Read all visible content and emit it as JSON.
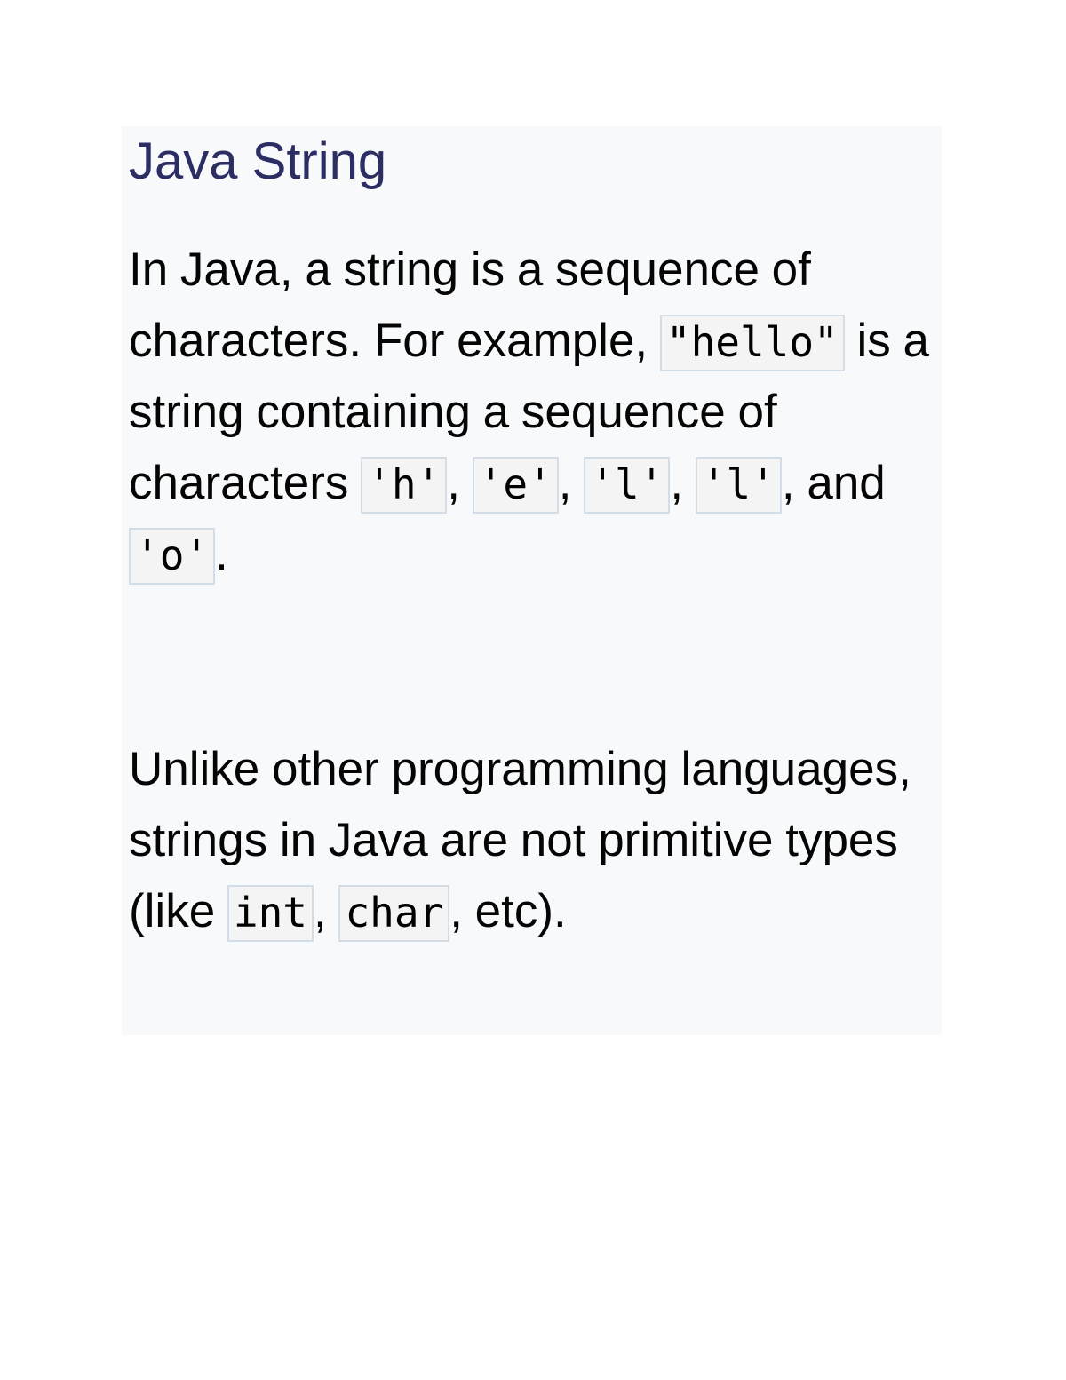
{
  "page": {
    "background_color": "#ffffff",
    "panel_background_color": "#f7f9fb"
  },
  "article": {
    "title": "Java String",
    "title_color": "#2b2d63",
    "body_text_color": "#050505",
    "code_background_color": "#f4f4f4",
    "code_border_color": "#d3dde8",
    "paragraphs": [
      {
        "id": "paragraph-1",
        "segments": [
          {
            "type": "text",
            "value": "In Java, a string is a sequence of characters. For example, "
          },
          {
            "type": "code",
            "value": "\"hello\""
          },
          {
            "type": "text",
            "value": " is a string containing a sequence of characters "
          },
          {
            "type": "code",
            "value": "'h'"
          },
          {
            "type": "text",
            "value": ", "
          },
          {
            "type": "code",
            "value": "'e'"
          },
          {
            "type": "text",
            "value": ", "
          },
          {
            "type": "code",
            "value": "'l'"
          },
          {
            "type": "text",
            "value": ", "
          },
          {
            "type": "code",
            "value": "'l'"
          },
          {
            "type": "text",
            "value": ", and "
          },
          {
            "type": "code",
            "value": "'o'"
          },
          {
            "type": "text",
            "value": "."
          }
        ]
      },
      {
        "id": "paragraph-2",
        "segments": [
          {
            "type": "text",
            "value": "Unlike other programming languages, strings in Java are not primitive types (like "
          },
          {
            "type": "code",
            "value": "int"
          },
          {
            "type": "text",
            "value": ", "
          },
          {
            "type": "code",
            "value": "char"
          },
          {
            "type": "text",
            "value": ", etc)."
          }
        ]
      }
    ]
  }
}
